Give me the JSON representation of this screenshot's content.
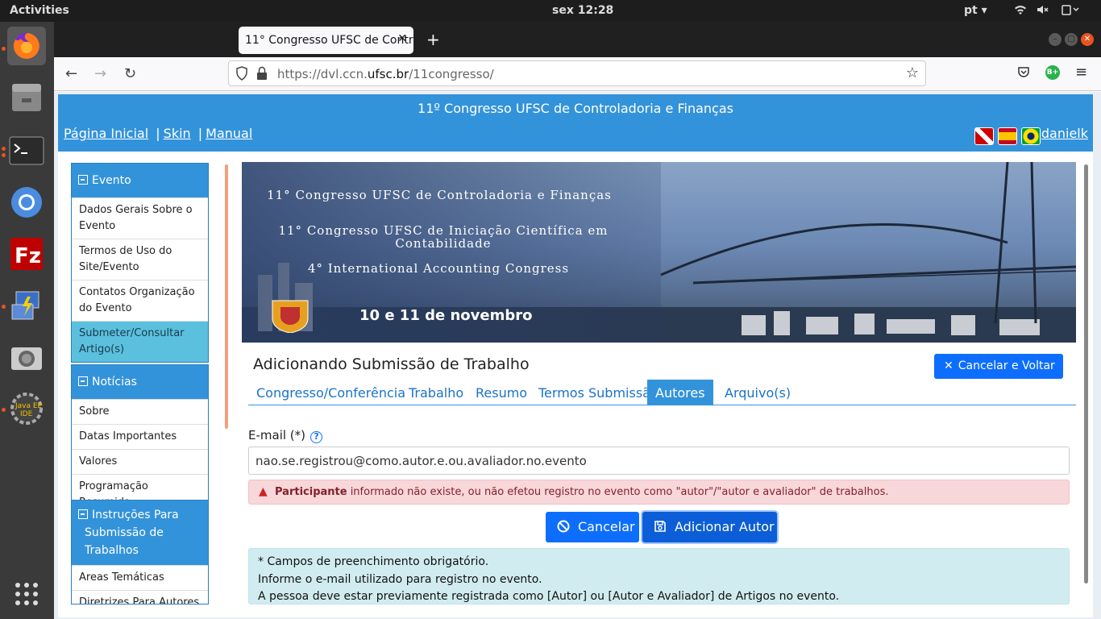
{
  "topbar": {
    "activities": "Activities",
    "clock": "sex 12:28",
    "lang": "pt ▾"
  },
  "browser": {
    "tab_title": "11° Congresso UFSC de Contr",
    "url_prefix": "https://dvl.ccn.",
    "url_domain": "ufsc.br",
    "url_suffix": "/11congresso/"
  },
  "header": {
    "title": "11º Congresso UFSC de Controladoria e Finanças",
    "links": [
      "Página Inicial",
      "Skin",
      "Manual"
    ],
    "user": "danielk"
  },
  "sidebar": {
    "evento": {
      "title": "Evento",
      "items": [
        "Dados Gerais Sobre o Evento",
        "Termos de Uso do Site/Evento",
        "Contatos Organização do Evento",
        "Submeter/Consultar Artigo(s)"
      ]
    },
    "noticias": {
      "title": "Notícias",
      "items": [
        "Sobre",
        "Datas Importantes",
        "Valores",
        "Programação Resumida"
      ]
    },
    "instrucoes": {
      "title": "Instruções Para Submissão de Trabalhos",
      "items": [
        "Areas Temáticas",
        "Diretrizes Para Autores"
      ]
    }
  },
  "banner": {
    "line1": "11° Congresso UFSC de Controladoria e Finanças",
    "line2": "11° Congresso UFSC de Iniciação Científica em Contabilidade",
    "line3": "4° International Accounting Congress",
    "date": "10 e 11 de novembro"
  },
  "main": {
    "heading": "Adicionando Submissão de Trabalho",
    "cancel_back": "Cancelar e Voltar",
    "tabs": [
      "Congresso/Conferência",
      "Trabalho",
      "Resumo",
      "Termos Submissão",
      "Autores",
      "Arquivo(s)"
    ],
    "email_label": "E-mail (*)",
    "email_value": "nao.se.registrou@como.autor.e.ou.avaliador.no.evento",
    "alert_bold": "Participante",
    "alert_text": " informado não existe, ou não efetou registro no evento como \"autor\"/\"autor e avaliador\" de trabalhos.",
    "btn_cancel": "Cancelar",
    "btn_add": "Adicionar Autor",
    "info": [
      "* Campos de preenchimento obrigatório.",
      "Informe o e-mail utilizado para registro no evento.",
      "A pessoa deve estar previamente registrada como [Autor] ou [Autor e Avaliador] de Artigos no evento."
    ]
  }
}
